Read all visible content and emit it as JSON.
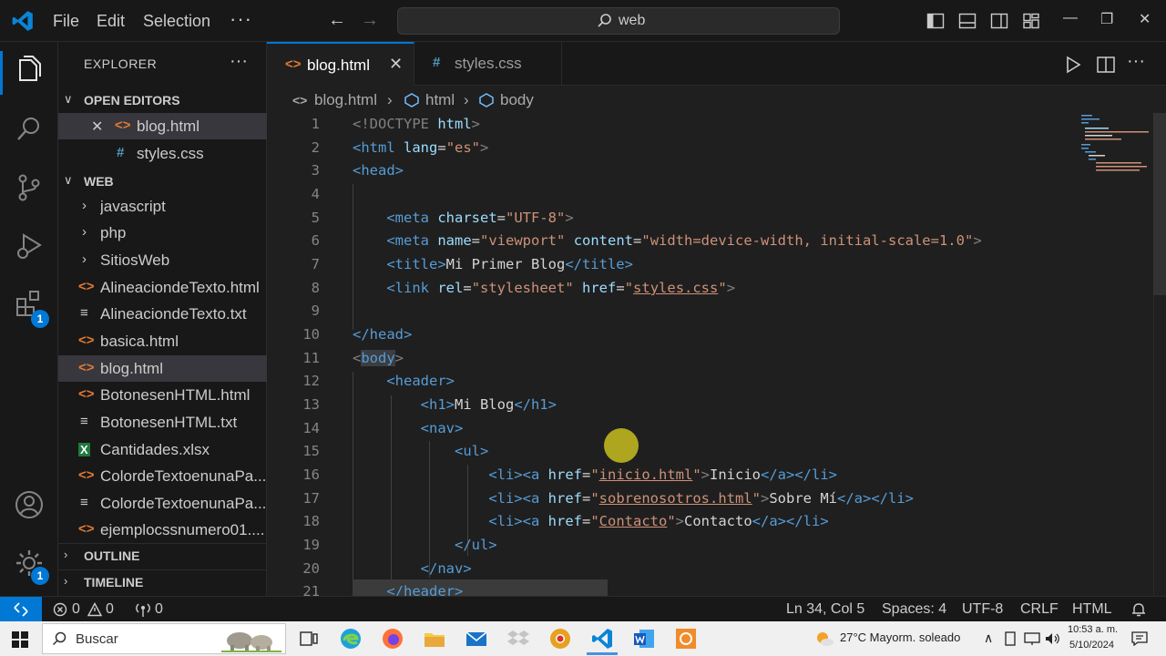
{
  "titlebar": {
    "menu": [
      "File",
      "Edit",
      "Selection"
    ],
    "more": "···",
    "search_text": "web",
    "back": "←",
    "forward": "→",
    "minimize": "—",
    "maximize": "❐",
    "close": "✕"
  },
  "activity": {
    "extensions_badge": "1",
    "settings_badge": "1"
  },
  "sidebar": {
    "title": "EXPLORER",
    "more": "···",
    "open_editors_label": "OPEN EDITORS",
    "open_editors": [
      {
        "name": "blog.html",
        "type": "html",
        "close": "✕"
      },
      {
        "name": "styles.css",
        "type": "css"
      }
    ],
    "workspace_label": "WEB",
    "files": [
      {
        "name": "javascript",
        "type": "folder"
      },
      {
        "name": "php",
        "type": "folder"
      },
      {
        "name": "SitiosWeb",
        "type": "folder"
      },
      {
        "name": "AlineaciondeTexto.html",
        "type": "html"
      },
      {
        "name": "AlineaciondeTexto.txt",
        "type": "txt"
      },
      {
        "name": "basica.html",
        "type": "html"
      },
      {
        "name": "blog.html",
        "type": "html"
      },
      {
        "name": "BotonesenHTML.html",
        "type": "html"
      },
      {
        "name": "BotonesenHTML.txt",
        "type": "txt"
      },
      {
        "name": "Cantidades.xlsx",
        "type": "xlsx"
      },
      {
        "name": "ColordeTextoenunaPa...",
        "type": "html"
      },
      {
        "name": "ColordeTextoenunaPa...",
        "type": "txt"
      },
      {
        "name": "ejemplocssnumero01....",
        "type": "html"
      }
    ],
    "outline_label": "OUTLINE",
    "timeline_label": "TIMELINE"
  },
  "tabs": [
    {
      "name": "blog.html",
      "type": "html",
      "active": true,
      "close": "✕"
    },
    {
      "name": "styles.css",
      "type": "css",
      "active": false
    }
  ],
  "breadcrumb": [
    "blog.html",
    "html",
    "body"
  ],
  "code_lines": [
    "1",
    "2",
    "3",
    "4",
    "5",
    "6",
    "7",
    "8",
    "9",
    "10",
    "11",
    "12",
    "13",
    "14",
    "15",
    "16",
    "17",
    "18",
    "19",
    "20",
    "21"
  ],
  "code": {
    "l1_doctype": "<!DOCTYPE",
    "l1_html": "html",
    "l1_close": ">",
    "l2_open": "<html",
    "l2_attr": "lang",
    "l2_val": "\"es\"",
    "l3": "<head>",
    "l5_tag": "<meta",
    "l5_attr": "charset",
    "l5_val": "\"UTF-8\"",
    "l6_tag": "<meta",
    "l6_attr1": "name",
    "l6_val1": "\"viewport\"",
    "l6_attr2": "content",
    "l6_val2": "\"width=device-width, initial-scale=1.0\"",
    "l7_open": "<title>",
    "l7_text": "Mi Primer Blog",
    "l7_close": "</title>",
    "l8_tag": "<link",
    "l8_attr1": "rel",
    "l8_val1": "\"stylesheet\"",
    "l8_attr2": "href",
    "l8_val2": "styles.css",
    "l10": "</head>",
    "l11_body": "body",
    "l12": "<header>",
    "l13_open": "<h1>",
    "l13_text": "Mi Blog",
    "l13_close": "</h1>",
    "l14": "<nav>",
    "l15": "<ul>",
    "l16_href": "inicio.html",
    "l16_text": "Inicio",
    "l17_href": "sobrenosotros.html",
    "l17_text": "Sobre Mí",
    "l18_href": "Contacto",
    "l18_text": "Contacto",
    "l19": "</ul>",
    "l20": "</nav>",
    "l21": "</header>"
  },
  "status": {
    "errors": "0",
    "warnings": "0",
    "ports": "0",
    "position": "Ln 34, Col 5",
    "spaces": "Spaces: 4",
    "encoding": "UTF-8",
    "eol": "CRLF",
    "language": "HTML"
  },
  "taskbar": {
    "search_placeholder": "Buscar",
    "weather": "27°C  Mayorm. soleado",
    "time": "10:53 a. m.",
    "date": "5/10/2024"
  },
  "colors": {
    "accent": "#0078d4",
    "html_icon": "#e37933",
    "css_icon": "#519aba",
    "tag": "#569cd6",
    "attr": "#9cdcfe",
    "string": "#ce9178"
  }
}
